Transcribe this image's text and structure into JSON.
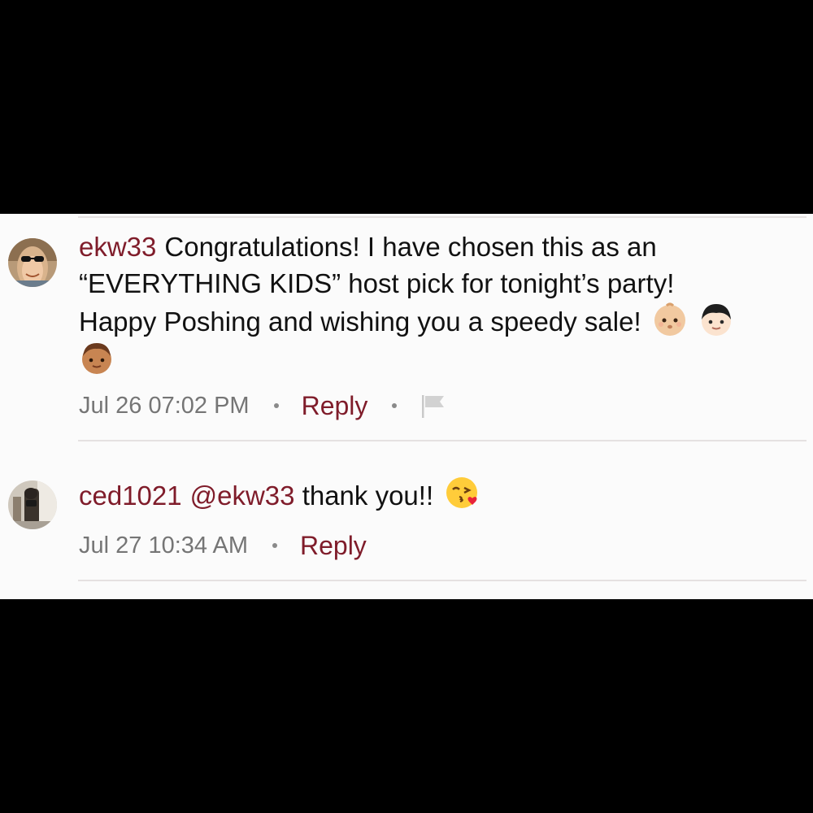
{
  "comments": [
    {
      "username": "ekw33",
      "text_line1": "Congratulations! I have chosen this as an",
      "text_line2": "“EVERYTHING KIDS” host pick for tonight’s party!",
      "text_line3": "Happy Poshing and wishing you a speedy sale!",
      "emojis": [
        "baby-light-skin-emoji",
        "child-light-skin-emoji",
        "boy-medium-skin-emoji"
      ],
      "timestamp": "Jul 26 07:02 PM",
      "reply_label": "Reply",
      "has_flag": true
    },
    {
      "username": "ced1021",
      "mention": "@ekw33",
      "text": "thank you!!",
      "emojis": [
        "face-blowing-kiss-emoji"
      ],
      "timestamp": "Jul 27 10:34 AM",
      "reply_label": "Reply",
      "has_flag": false
    }
  ],
  "colors": {
    "accent": "#7f1c2a",
    "text": "#111111",
    "muted": "#757575",
    "background": "#fbfbfb",
    "divider": "#e5e1e1",
    "letterbox": "#000000"
  }
}
